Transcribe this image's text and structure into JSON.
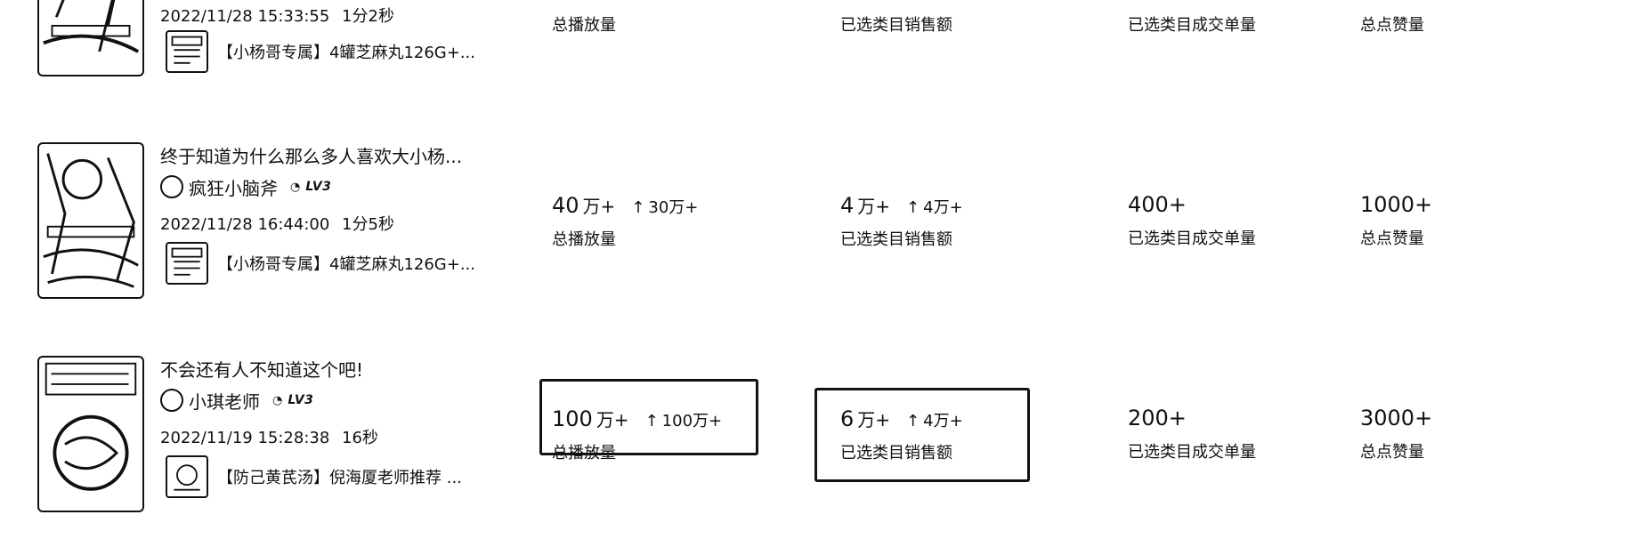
{
  "rows": [
    {
      "title": "",
      "author": "",
      "level": "",
      "date": "2022/11/28 15:33:55",
      "duration": "1分2秒",
      "product": "【小杨哥专属】4罐芝麻丸126G+...",
      "stats": {
        "plays": {
          "value": "",
          "unit": "",
          "delta": "",
          "label": "总播放量"
        },
        "sales": {
          "value": "",
          "unit": "",
          "delta": "",
          "label": "已选类目销售额"
        },
        "orders": {
          "value": "",
          "label": "已选类目成交单量"
        },
        "likes": {
          "value": "",
          "label": "总点赞量"
        }
      }
    },
    {
      "title": "终于知道为什么那么多人喜欢大小杨...",
      "author": "疯狂小脑斧",
      "level": "LV3",
      "date": "2022/11/28 16:44:00",
      "duration": "1分5秒",
      "product": "【小杨哥专属】4罐芝麻丸126G+...",
      "stats": {
        "plays": {
          "value": "40",
          "unit": "万+",
          "delta": "30万+",
          "label": "总播放量"
        },
        "sales": {
          "value": "4",
          "unit": "万+",
          "delta": "4万+",
          "label": "已选类目销售额"
        },
        "orders": {
          "value": "400+",
          "label": "已选类目成交单量"
        },
        "likes": {
          "value": "1000+",
          "label": "总点赞量"
        }
      }
    },
    {
      "title": "不会还有人不知道这个吧!",
      "author": "小琪老师",
      "level": "LV3",
      "date": "2022/11/19 15:28:38",
      "duration": "16秒",
      "product": "【防己黄芪汤】倪海厦老师推荐 ...",
      "stats": {
        "plays": {
          "value": "100",
          "unit": "万+",
          "delta": "100万+",
          "label": "总播放量"
        },
        "sales": {
          "value": "6",
          "unit": "万+",
          "delta": "4万+",
          "label": "已选类目销售额"
        },
        "orders": {
          "value": "200+",
          "label": "已选类目成交单量"
        },
        "likes": {
          "value": "3000+",
          "label": "总点赞量"
        }
      }
    }
  ],
  "icons": {
    "up_arrow": "↑",
    "level_badge": "◔"
  }
}
